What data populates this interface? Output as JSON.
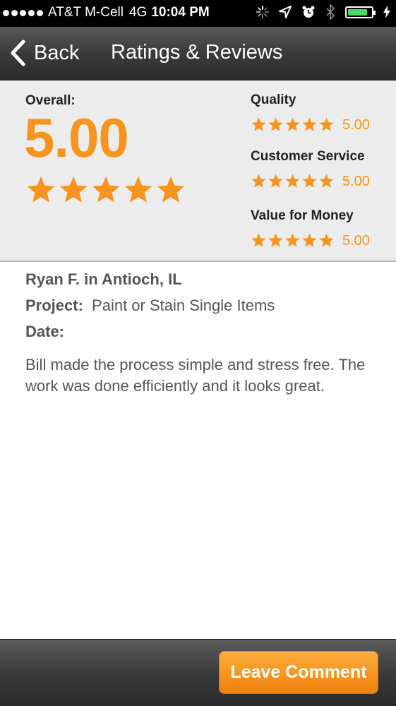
{
  "status_bar": {
    "carrier": "AT&T M-Cell",
    "network": "4G",
    "time": "10:04 PM",
    "battery_level": 0.85,
    "icons": [
      "signal-dots",
      "activity-spinner-icon",
      "location-arrow-icon",
      "alarm-clock-icon",
      "bluetooth-icon",
      "battery-icon",
      "charging-bolt-icon"
    ]
  },
  "nav": {
    "back_label": "Back",
    "title": "Ratings & Reviews"
  },
  "summary": {
    "overall_label": "Overall:",
    "overall_score": "5.00",
    "overall_stars": 5,
    "categories": [
      {
        "label": "Quality",
        "value": "5.00",
        "stars": 5
      },
      {
        "label": "Customer Service",
        "value": "5.00",
        "stars": 5
      },
      {
        "label": "Value for Money",
        "value": "5.00",
        "stars": 5
      }
    ]
  },
  "review": {
    "reviewer": "Ryan F. in Antioch, IL",
    "project_label": "Project:",
    "project_value": "Paint or Stain Single Items",
    "date_label": "Date:",
    "date_value": "",
    "body": "Bill made the process simple and stress free.  The work was done efficiently and it looks great."
  },
  "footer": {
    "leave_comment_label": "Leave Comment"
  },
  "colors": {
    "accent": "#f7941d",
    "nav_bg": "#3a3a3a",
    "summary_bg": "#ececec",
    "battery": "#4cd964"
  }
}
